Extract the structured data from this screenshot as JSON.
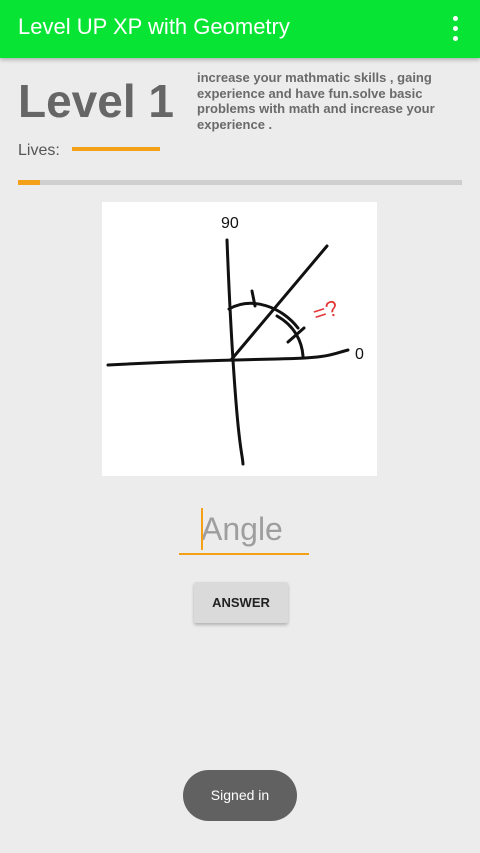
{
  "app_bar": {
    "title": "Level UP XP with Geometry",
    "menu_icon": "overflow-menu-icon",
    "color": "#08e434"
  },
  "level": {
    "title": "Level 1",
    "description": "increase your mathmatic skills , gaing experience and have fun.solve basic problems with math and increase your experience ."
  },
  "lives": {
    "label": "Lives:",
    "fraction": 1.0,
    "color": "#f5a019"
  },
  "progress": {
    "fraction": 0.05,
    "color": "#f5a019"
  },
  "question": {
    "label_top": "90",
    "label_right": "0",
    "label_unknown": "=?"
  },
  "answer": {
    "placeholder": "Angle",
    "value": "",
    "button_label": "ANSWER"
  },
  "toast": {
    "message": "Signed in"
  }
}
